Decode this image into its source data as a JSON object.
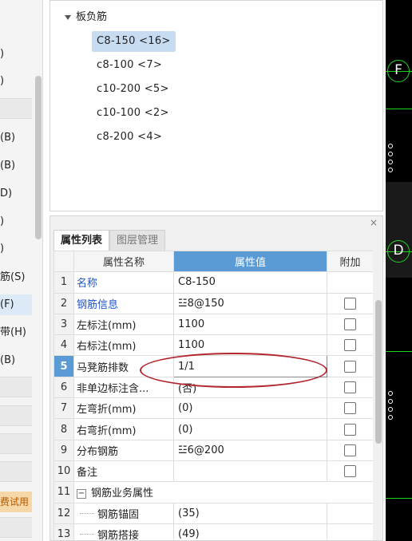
{
  "left_panel": {
    "rows": [
      ")",
      ")",
      "",
      "(B)",
      "(B)",
      "D)",
      ")",
      ")",
      "筋(S)",
      "(F)",
      "带(H)",
      "(B)",
      "",
      "",
      "",
      "",
      "",
      "费试用",
      ""
    ]
  },
  "tree": {
    "root_label": "板负筋",
    "items": [
      {
        "label": "C8-150 <16>",
        "selected": true
      },
      {
        "label": "c8-100 <7>",
        "selected": false
      },
      {
        "label": "c10-200 <5>",
        "selected": false
      },
      {
        "label": "c10-100 <2>",
        "selected": false
      },
      {
        "label": "c8-200 <4>",
        "selected": false
      }
    ]
  },
  "property_panel": {
    "close_label": "×",
    "tabs": [
      {
        "label": "属性列表",
        "active": true
      },
      {
        "label": "图层管理",
        "active": false
      }
    ],
    "headers": {
      "name": "属性名称",
      "value": "属性值",
      "extra": "附加"
    },
    "rows": [
      {
        "num": "1",
        "name": "名称",
        "value": "C8-150",
        "link": true,
        "checkbox": false
      },
      {
        "num": "2",
        "name": "钢筋信息",
        "value": "☳8@150",
        "link": true,
        "checkbox": true
      },
      {
        "num": "3",
        "name": "左标注(mm)",
        "value": "1100",
        "link": false,
        "checkbox": true
      },
      {
        "num": "4",
        "name": "右标注(mm)",
        "value": "1100",
        "link": false,
        "checkbox": true
      },
      {
        "num": "5",
        "name": "马凳筋排数",
        "value": "1/1",
        "link": false,
        "checkbox": true,
        "current": true
      },
      {
        "num": "6",
        "name": "非单边标注含...",
        "value": "(否)",
        "link": false,
        "checkbox": true
      },
      {
        "num": "7",
        "name": "左弯折(mm)",
        "value": "(0)",
        "link": false,
        "checkbox": true
      },
      {
        "num": "8",
        "name": "右弯折(mm)",
        "value": "(0)",
        "link": false,
        "checkbox": true
      },
      {
        "num": "9",
        "name": "分布钢筋",
        "value": "☳6@200",
        "link": false,
        "checkbox": true
      },
      {
        "num": "10",
        "name": "备注",
        "value": "",
        "link": false,
        "checkbox": true
      },
      {
        "num": "11",
        "name": "钢筋业务属性",
        "value": "",
        "link": false,
        "checkbox": false,
        "group": true,
        "expander": "−"
      },
      {
        "num": "12",
        "name": "钢筋锚固",
        "value": "(35)",
        "link": false,
        "checkbox": false,
        "child": true
      },
      {
        "num": "13",
        "name": "钢筋搭接",
        "value": "(49)",
        "link": false,
        "checkbox": false,
        "child": true
      }
    ]
  },
  "canvas": {
    "axis_labels": [
      "F",
      "D"
    ],
    "colors": {
      "grid_line": "#1ed31e",
      "background": "#000000",
      "annotation": "#b3262e",
      "header_accent": "#5b9bd5"
    }
  }
}
